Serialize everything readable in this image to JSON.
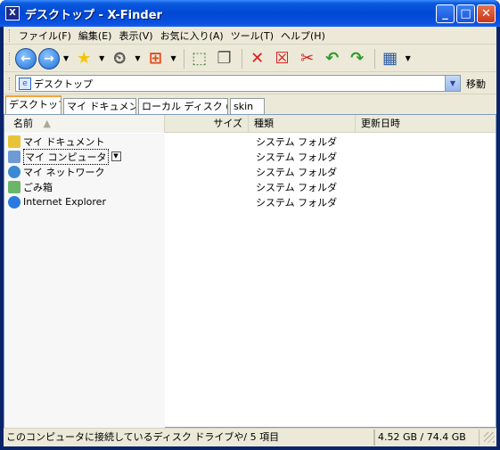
{
  "window": {
    "title": "デスクトップ - X-Finder",
    "app_icon": "X"
  },
  "colors": {
    "titlebar": "#0054e3",
    "close": "#d74b2a",
    "tab_accent": "#f7a13c"
  },
  "menu": [
    {
      "label": "ファイル(F)"
    },
    {
      "label": "編集(E)"
    },
    {
      "label": "表示(V)"
    },
    {
      "label": "お気に入り(A)"
    },
    {
      "label": "ツール(T)"
    },
    {
      "label": "ヘルプ(H)"
    }
  ],
  "toolbar": {
    "back_icon": "back-arrow-icon",
    "forward_icon": "forward-arrow-icon",
    "favorites_icon": "star-icon",
    "history_icon": "clock-icon",
    "windows_icon": "windows-flag-icon",
    "glyphs": {
      "back": "←",
      "forward": "→",
      "star": "★",
      "clock": "⏲",
      "flag": "⊞",
      "move_window": "⬚",
      "copy_window": "❐",
      "delete": "✕",
      "delete_file": "☒",
      "cut": "✂",
      "undo": "↶",
      "redo": "↷",
      "view": "▦"
    }
  },
  "address": {
    "value": "デスクトップ",
    "go_label": "移動",
    "dropdown_glyph": "▼"
  },
  "tabs": [
    {
      "label": "デスクトップ",
      "active": true
    },
    {
      "label": "マイ ドキュメント",
      "active": false
    },
    {
      "label": "ローカル ディスク (C",
      "active": false
    },
    {
      "label": "skin",
      "active": false
    }
  ],
  "columns": {
    "name": "名前",
    "size": "サイズ",
    "type": "種類",
    "modified": "更新日時",
    "sort_glyph": "▲"
  },
  "files": [
    {
      "name": "マイ ドキュメント",
      "size": "",
      "type": "システム フォルダ",
      "modified": "",
      "icon": "my-documents-icon",
      "color": "#e8c33a"
    },
    {
      "name": "マイ コンピュータ",
      "size": "",
      "type": "システム フォルダ",
      "modified": "",
      "icon": "my-computer-icon",
      "color": "#6c9bd6",
      "selected": true
    },
    {
      "name": "マイ ネットワーク",
      "size": "",
      "type": "システム フォルダ",
      "modified": "",
      "icon": "network-icon",
      "color": "#3a8ad6"
    },
    {
      "name": "ごみ箱",
      "size": "",
      "type": "システム フォルダ",
      "modified": "",
      "icon": "recycle-bin-icon",
      "color": "#6bb56b"
    },
    {
      "name": "Internet Explorer",
      "size": "",
      "type": "システム フォルダ",
      "modified": "",
      "icon": "internet-explorer-icon",
      "color": "#2a7be0"
    }
  ],
  "status": {
    "message": "このコンピュータに接続しているディスク ドライブや/ 5 項目",
    "disk": "4.52 GB / 74.4 GB"
  }
}
